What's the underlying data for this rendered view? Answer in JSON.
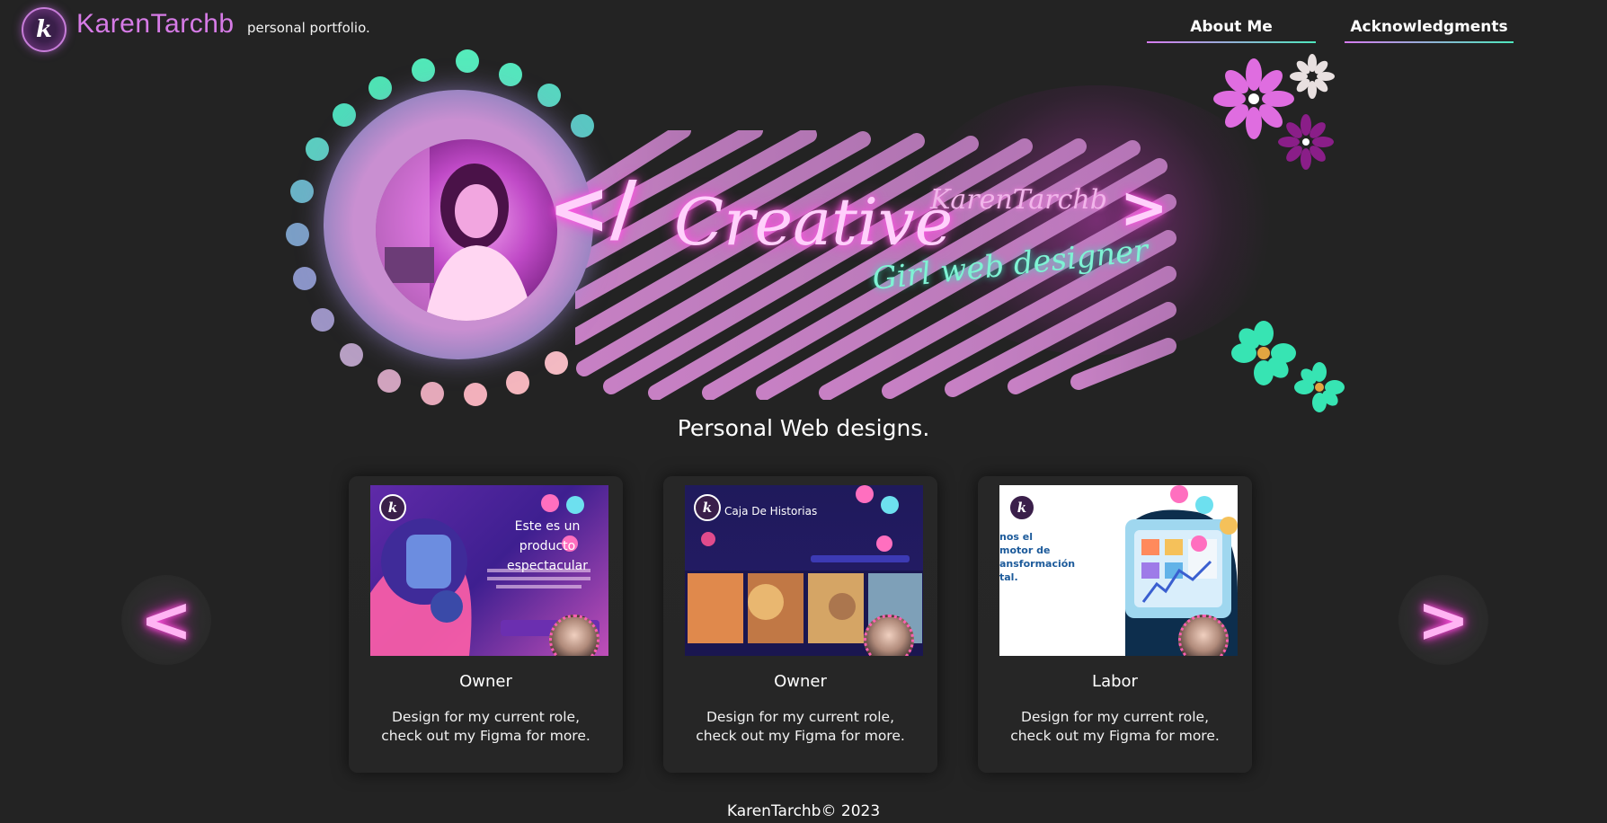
{
  "header": {
    "logo_letter": "k",
    "brand": "KarenTarchb",
    "tagline": "personal portfolio.",
    "nav": {
      "about": "About Me",
      "acknowledgments": "Acknowledgments"
    }
  },
  "hero": {
    "open_bracket": "</",
    "close_bracket": ">",
    "creative": "Creative",
    "name": "KarenTarchb",
    "subtitle": "Girl web designer"
  },
  "section": {
    "title": "Personal Web designs."
  },
  "carousel": {
    "prev_label": "<",
    "next_label": ">"
  },
  "cards": [
    {
      "role": "Owner",
      "description": "Design for my current role, check out my Figma for more.",
      "thumb_text": "Este es un producto espectacular"
    },
    {
      "role": "Owner",
      "description": "Design for my current role, check out my Figma for more.",
      "thumb_text": "Caja De Historias"
    },
    {
      "role": "Labor",
      "description": "Design for my current role, check out my Figma for more.",
      "thumb_text": "nos el motor de ansformación tal."
    }
  ],
  "footer": {
    "copyright": "KarenTarchb© 2023"
  },
  "colors": {
    "background": "#232323",
    "brand_pink": "#d67be6",
    "neon_pink": "#ff5ce6",
    "neon_mint": "#35e6c0"
  }
}
